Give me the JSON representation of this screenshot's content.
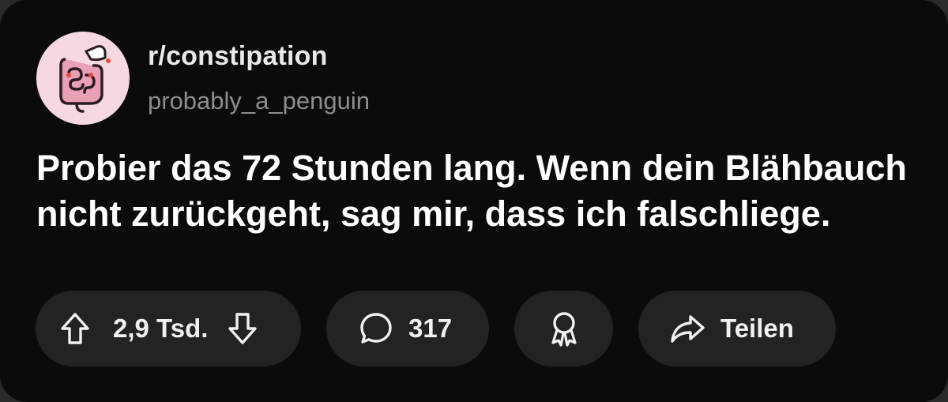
{
  "post": {
    "subreddit": "r/constipation",
    "username": "probably_a_penguin",
    "title": "Probier das 72 Stunden lang. Wenn dein Blähbauch nicht zurückgeht, sag mir, dass ich falschliege.",
    "avatar_icon": "intestine-icon"
  },
  "actions": {
    "upvote_count": "2,9 Tsd.",
    "comment_count": "317",
    "share_label": "Teilen"
  },
  "colors": {
    "background": "#0b0b0c",
    "pill": "#232325",
    "avatar_bg": "#f6d9e0",
    "avatar_accent": "#e8a0b4",
    "username": "#8d8d92"
  }
}
